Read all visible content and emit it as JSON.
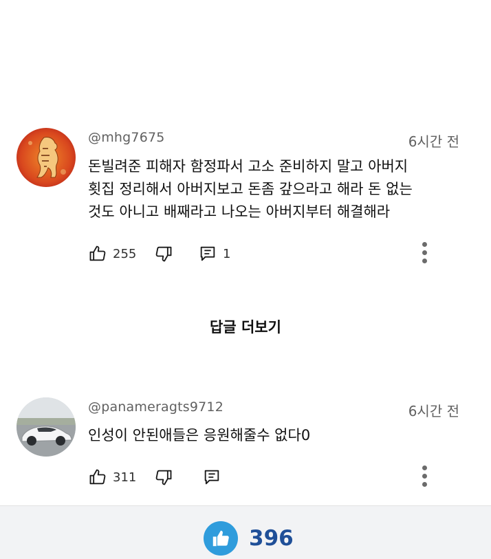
{
  "comments": [
    {
      "handle": "@mhg7675",
      "time": "6시간 전",
      "text": "돈빌려준 피해자 함정파서 고소 준비하지 말고 아버지\n횟집 정리해서 아버지보고 돈좀 갚으라고 해라 돈 없는\n것도 아니고 배째라고 나오는 아버지부터 해결해라",
      "likes": "255",
      "replies": "1",
      "avatar": "tiger-avatar"
    },
    {
      "handle": "@panameragts9712",
      "time": "6시간 전",
      "text": "인성이 안된애들은 응원해줄수 없다0",
      "likes": "311",
      "replies": "",
      "avatar": "car-avatar"
    }
  ],
  "view_replies_label": "답글 더보기",
  "footer": {
    "like_total": "396"
  },
  "colors": {
    "accent": "#2f9cdc",
    "count_text": "#1f4f98"
  }
}
